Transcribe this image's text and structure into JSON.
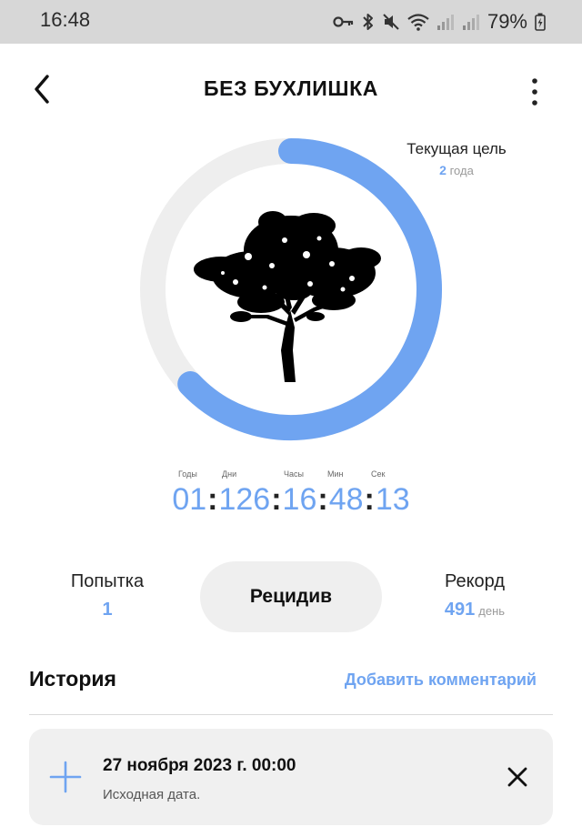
{
  "status_bar": {
    "time": "16:48",
    "battery": "79%",
    "icons": [
      "vpn-key-icon",
      "bluetooth-icon",
      "mute-icon",
      "wifi-icon",
      "signal-icon",
      "signal-icon",
      "battery-charging-icon"
    ]
  },
  "header": {
    "title": "БЕЗ БУХЛИШКА",
    "back_icon": "chevron-left-icon",
    "menu_icon": "more-vertical-icon"
  },
  "goal": {
    "label": "Текущая цель",
    "value": "2",
    "unit": "года",
    "progress_fraction": 0.63
  },
  "timer": {
    "labels": {
      "years": "Годы",
      "days": "Дни",
      "hours": "Часы",
      "minutes": "Мин",
      "seconds": "Сек"
    },
    "years": "01",
    "days": "126",
    "hours": "16",
    "minutes": "48",
    "seconds": "13"
  },
  "stats": {
    "attempt_label": "Попытка",
    "attempt_value": "1",
    "record_label": "Рекорд",
    "record_value": "491",
    "record_unit": "день"
  },
  "relapse_button": "Рецидив",
  "history": {
    "title": "История",
    "add_comment": "Добавить комментарий",
    "items": [
      {
        "date": "27 ноября 2023 г. 00:00",
        "note": "Исходная дата."
      }
    ]
  },
  "colors": {
    "accent": "#6fa4f1",
    "ring_track": "#eeeeee",
    "card_bg": "#f0f0f0",
    "status_bar_bg": "#d7d7d7"
  }
}
